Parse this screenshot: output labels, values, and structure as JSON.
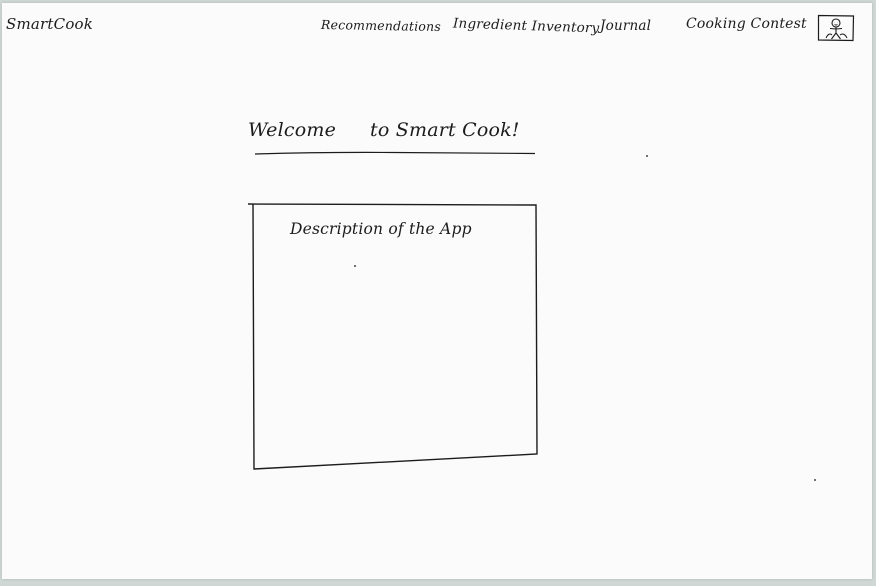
{
  "app": {
    "brand": "SmartCook"
  },
  "nav": {
    "items": [
      {
        "id": "recommendations",
        "label": "Recommendations"
      },
      {
        "id": "inventory",
        "label": "Ingredient Inventory"
      },
      {
        "id": "journal",
        "label": "Journal"
      },
      {
        "id": "contest",
        "label": "Cooking Contest"
      }
    ],
    "profile_icon": "user-profile-icon"
  },
  "main": {
    "welcome_part1": "Welcome",
    "welcome_part2": "to Smart Cook!",
    "description_title": "Description of the App"
  }
}
